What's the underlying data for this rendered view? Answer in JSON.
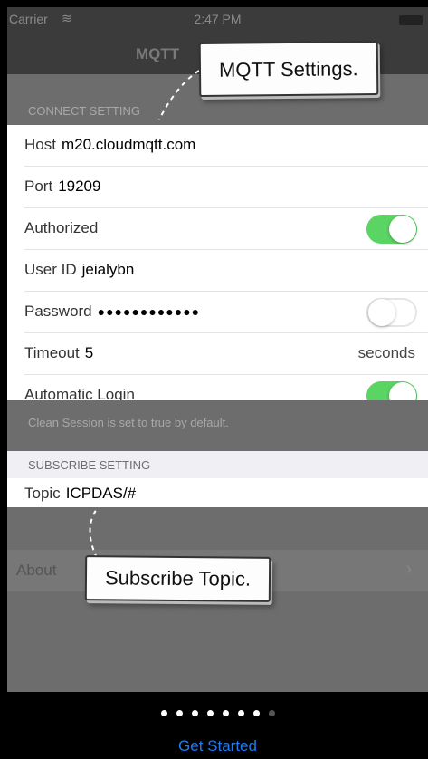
{
  "status_bar": {
    "carrier": "Carrier",
    "time": "2:47 PM"
  },
  "nav": {
    "title": "MQTT"
  },
  "connect_section": {
    "header": "CONNECT SETTING",
    "host": {
      "label": "Host",
      "value": "m20.cloudmqtt.com"
    },
    "port": {
      "label": "Port",
      "value": "19209"
    },
    "authorized": {
      "label": "Authorized",
      "on": true
    },
    "user_id": {
      "label": "User ID",
      "value": "jeialybn"
    },
    "password": {
      "label": "Password",
      "value": "●●●●●●●●●●●●",
      "toggle_on": false
    },
    "timeout": {
      "label": "Timeout",
      "value": "5",
      "unit": "seconds"
    },
    "automatic_login": {
      "label": "Automatic Login",
      "on": true
    },
    "footer": "Clean Session is set to true by default."
  },
  "subscribe_section": {
    "header": "SUBSCRIBE SETTING",
    "topic": {
      "label": "Topic",
      "value": "ICPDAS/#"
    }
  },
  "about": {
    "label": "About"
  },
  "pager": {
    "total": 8,
    "current": 7
  },
  "bottom": {
    "get_started": "Get Started"
  },
  "callouts": {
    "mqtt": "MQTT Settings.",
    "topic": "Subscribe Topic."
  },
  "colors": {
    "toggle_on": "#5ad463",
    "link": "#1e7cf0"
  }
}
